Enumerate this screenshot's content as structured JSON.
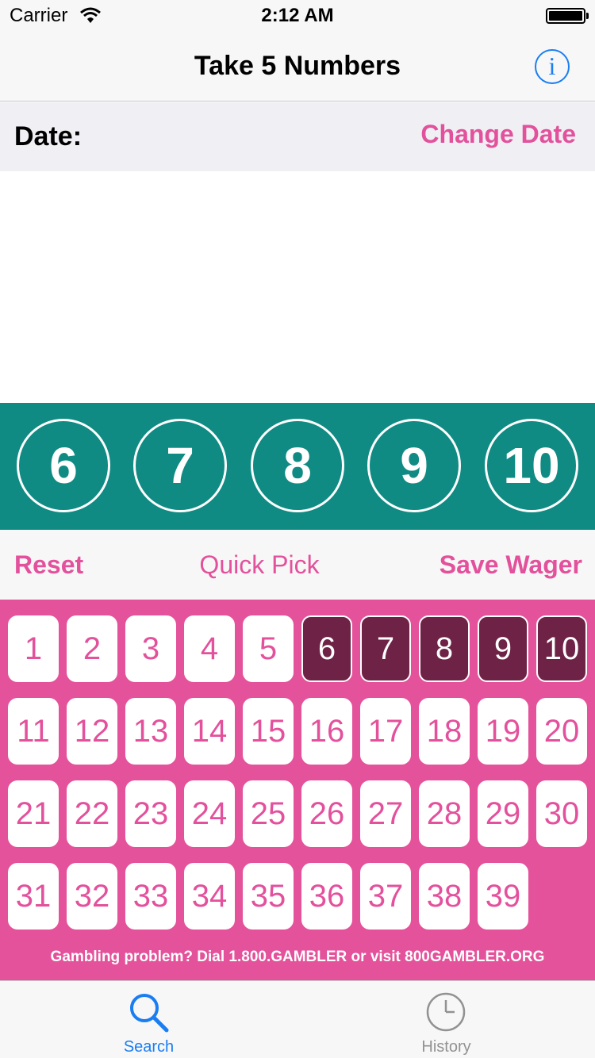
{
  "status_bar": {
    "carrier": "Carrier",
    "time": "2:12 AM"
  },
  "nav": {
    "title": "Take 5 Numbers",
    "info_glyph": "i"
  },
  "date_row": {
    "label": "Date:",
    "change_label": "Change Date"
  },
  "selected_numbers": [
    "6",
    "7",
    "8",
    "9",
    "10"
  ],
  "actions": {
    "reset": "Reset",
    "quick_pick": "Quick Pick",
    "save": "Save Wager"
  },
  "numbers": [
    "1",
    "2",
    "3",
    "4",
    "5",
    "6",
    "7",
    "8",
    "9",
    "10",
    "11",
    "12",
    "13",
    "14",
    "15",
    "16",
    "17",
    "18",
    "19",
    "20",
    "21",
    "22",
    "23",
    "24",
    "25",
    "26",
    "27",
    "28",
    "29",
    "30",
    "31",
    "32",
    "33",
    "34",
    "35",
    "36",
    "37",
    "38",
    "39"
  ],
  "selected": [
    "6",
    "7",
    "8",
    "9",
    "10"
  ],
  "footer_note": "Gambling problem? Dial 1.800.GAMBLER or visit 800GAMBLER.ORG",
  "tabs": [
    {
      "label": "Search",
      "icon": "search-icon",
      "active": true
    },
    {
      "label": "History",
      "icon": "clock-icon",
      "active": false
    }
  ],
  "colors": {
    "accent_pink": "#e3519c",
    "grid_pink": "#e3529b",
    "teal": "#0f8b83",
    "selected_tile": "#6e2346",
    "ios_blue": "#1a7ef2"
  }
}
